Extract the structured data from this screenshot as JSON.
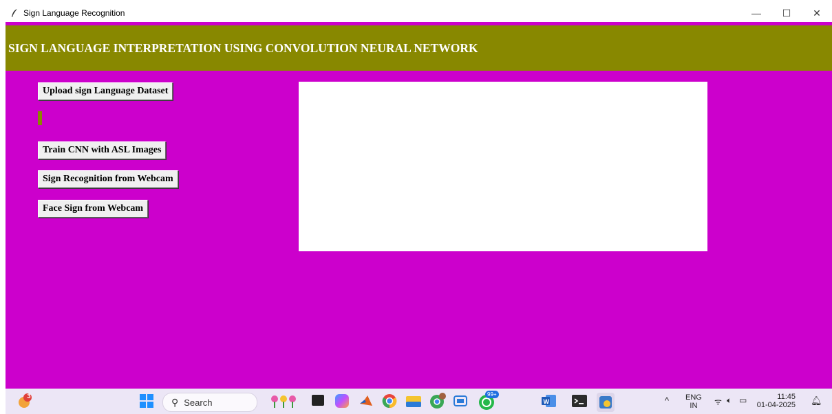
{
  "window": {
    "title": "Sign Language Recognition",
    "controls": {
      "minimize": "—",
      "maximize": "☐",
      "close": "✕"
    }
  },
  "app": {
    "heading": "SIGN LANGUAGE INTERPRETATION USING CONVOLUTION NEURAL NETWORK",
    "buttons": {
      "upload": "Upload sign Language Dataset",
      "train": "Train CNN with ASL Images",
      "webcam": "Sign Recognition from Webcam",
      "face": "Face Sign from Webcam"
    },
    "colors": {
      "background": "#cc00cc",
      "header": "#888800",
      "text_area": "#ffffff"
    }
  },
  "taskbar": {
    "search_placeholder": "Search",
    "notification_badge": "3",
    "whatsapp_badge": "99+",
    "language": "ENG",
    "region": "IN",
    "time": "11:45",
    "date": "01-04-2025",
    "icons": [
      "weather-icon",
      "start-icon",
      "search-icon",
      "widgets-icon",
      "task-view-icon",
      "copilot-icon",
      "matlab-icon",
      "chrome-icon",
      "file-explorer-icon",
      "chrome-profile-icon",
      "photos-icon",
      "whatsapp-icon",
      "word-icon",
      "terminal-icon",
      "python-idle-icon",
      "chevron-up-icon",
      "wifi-icon",
      "volume-icon",
      "battery-icon",
      "notification-icon"
    ]
  }
}
